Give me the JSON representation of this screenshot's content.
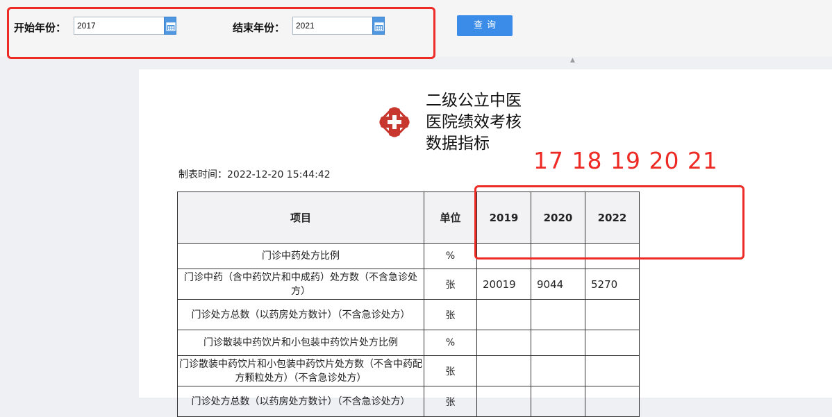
{
  "filter": {
    "start_label": "开始年份：",
    "start_value": "2017",
    "end_label": "结束年份：",
    "end_value": "2021",
    "query_label": "查询"
  },
  "report": {
    "title_lines": [
      "二级公立中医",
      "医院绩效考核",
      "数据指标"
    ],
    "made_time": "制表时间：2022-12-20 15:44:42",
    "annotation": "17 18 19 20 21",
    "table": {
      "headers": [
        "项目",
        "单位",
        "2019",
        "2020",
        "2022"
      ],
      "rows": [
        {
          "item": "门诊中药处方比例",
          "unit": "%",
          "values": [
            "",
            "",
            ""
          ]
        },
        {
          "item": "门诊中药（含中药饮片和中成药）处方数（不含急诊处方）",
          "unit": "张",
          "values": [
            "20019",
            "9044",
            "5270"
          ]
        },
        {
          "item": "门诊处方总数（以药房处方数计）（不含急诊处方）",
          "unit": "张",
          "values": [
            "",
            "",
            ""
          ]
        },
        {
          "item": "门诊散装中药饮片和小包装中药饮片处方比例",
          "unit": "%",
          "values": [
            "",
            "",
            ""
          ]
        },
        {
          "item": "门诊散装中药饮片和小包装中药饮片处方数（不含中药配方颗粒处方）（不含急诊处方）",
          "unit": "张",
          "values": [
            "",
            "",
            ""
          ]
        },
        {
          "item": "门诊处方总数（以药房处方数计）（不含急诊处方）",
          "unit": "张",
          "values": [
            "",
            "",
            ""
          ]
        }
      ]
    }
  },
  "colors": {
    "accent": "#3b8ce8",
    "annotation": "#ee2a24",
    "logo": "#c8372d"
  }
}
